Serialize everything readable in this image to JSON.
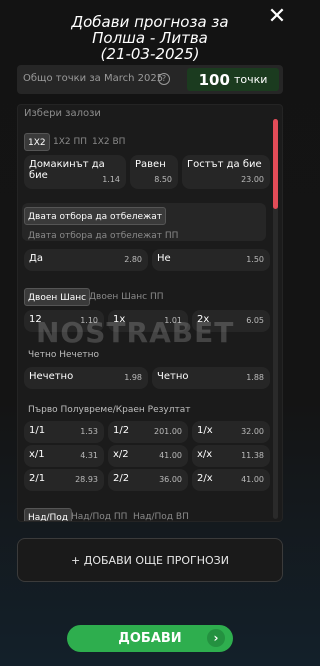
{
  "header": {
    "title_line1": "Добави прогноза за",
    "title_line2": "Полша - Литва",
    "title_line3": "(21-03-2025)",
    "close_glyph": "✕"
  },
  "points": {
    "label": "Общо точки за March 2025",
    "help_glyph": "?",
    "value": "100",
    "unit": "точки"
  },
  "panel": {
    "heading": "Избери залози",
    "tabs_1x2": [
      "1X2",
      "1X2 ПП",
      "1X2 ВП"
    ],
    "options_1x2": [
      {
        "label": "Домакинът да бие",
        "odd": "1.14"
      },
      {
        "label": "Равен",
        "odd": "8.50"
      },
      {
        "label": "Гостът да бие",
        "odd": "23.00"
      }
    ],
    "btts_tab": "Двата отбора да отбележат",
    "btts_sub": "Двата отбора да отбележат ПП",
    "btts_options": [
      {
        "label": "Да",
        "odd": "2.80"
      },
      {
        "label": "Не",
        "odd": "1.50"
      }
    ],
    "dc_tabs": [
      "Двоен Шанс",
      "Двоен Шанс ПП"
    ],
    "dc_options": [
      {
        "label": "12",
        "odd": "1.10"
      },
      {
        "label": "1x",
        "odd": "1.01"
      },
      {
        "label": "2x",
        "odd": "6.05"
      }
    ],
    "oe_title": "Четно Нечетно",
    "oe_options": [
      {
        "label": "Нечетно",
        "odd": "1.98"
      },
      {
        "label": "Четно",
        "odd": "1.88"
      }
    ],
    "htft_title": "Първо Полувреме/Краен Резултат",
    "htft_options": [
      {
        "label": "1/1",
        "odd": "1.53"
      },
      {
        "label": "1/2",
        "odd": "201.00"
      },
      {
        "label": "1/x",
        "odd": "32.00"
      },
      {
        "label": "x/1",
        "odd": "4.31"
      },
      {
        "label": "x/2",
        "odd": "41.00"
      },
      {
        "label": "x/x",
        "odd": "11.38"
      },
      {
        "label": "2/1",
        "odd": "28.93"
      },
      {
        "label": "2/2",
        "odd": "36.00"
      },
      {
        "label": "2/x",
        "odd": "41.00"
      }
    ],
    "ou_tabs": [
      "Над/Под",
      "Над/Под ПП",
      "Над/Под ВП"
    ]
  },
  "watermark": "NOSTRABET",
  "add_more_label": "+ ДОБАВИ ОЩЕ ПРОГНОЗИ",
  "submit_label": "ДОБАВИ",
  "submit_chevron": "›",
  "colors": {
    "accent_red": "#e24c58",
    "accent_green": "#2eae4e",
    "badge_green": "#1b3b1f"
  }
}
